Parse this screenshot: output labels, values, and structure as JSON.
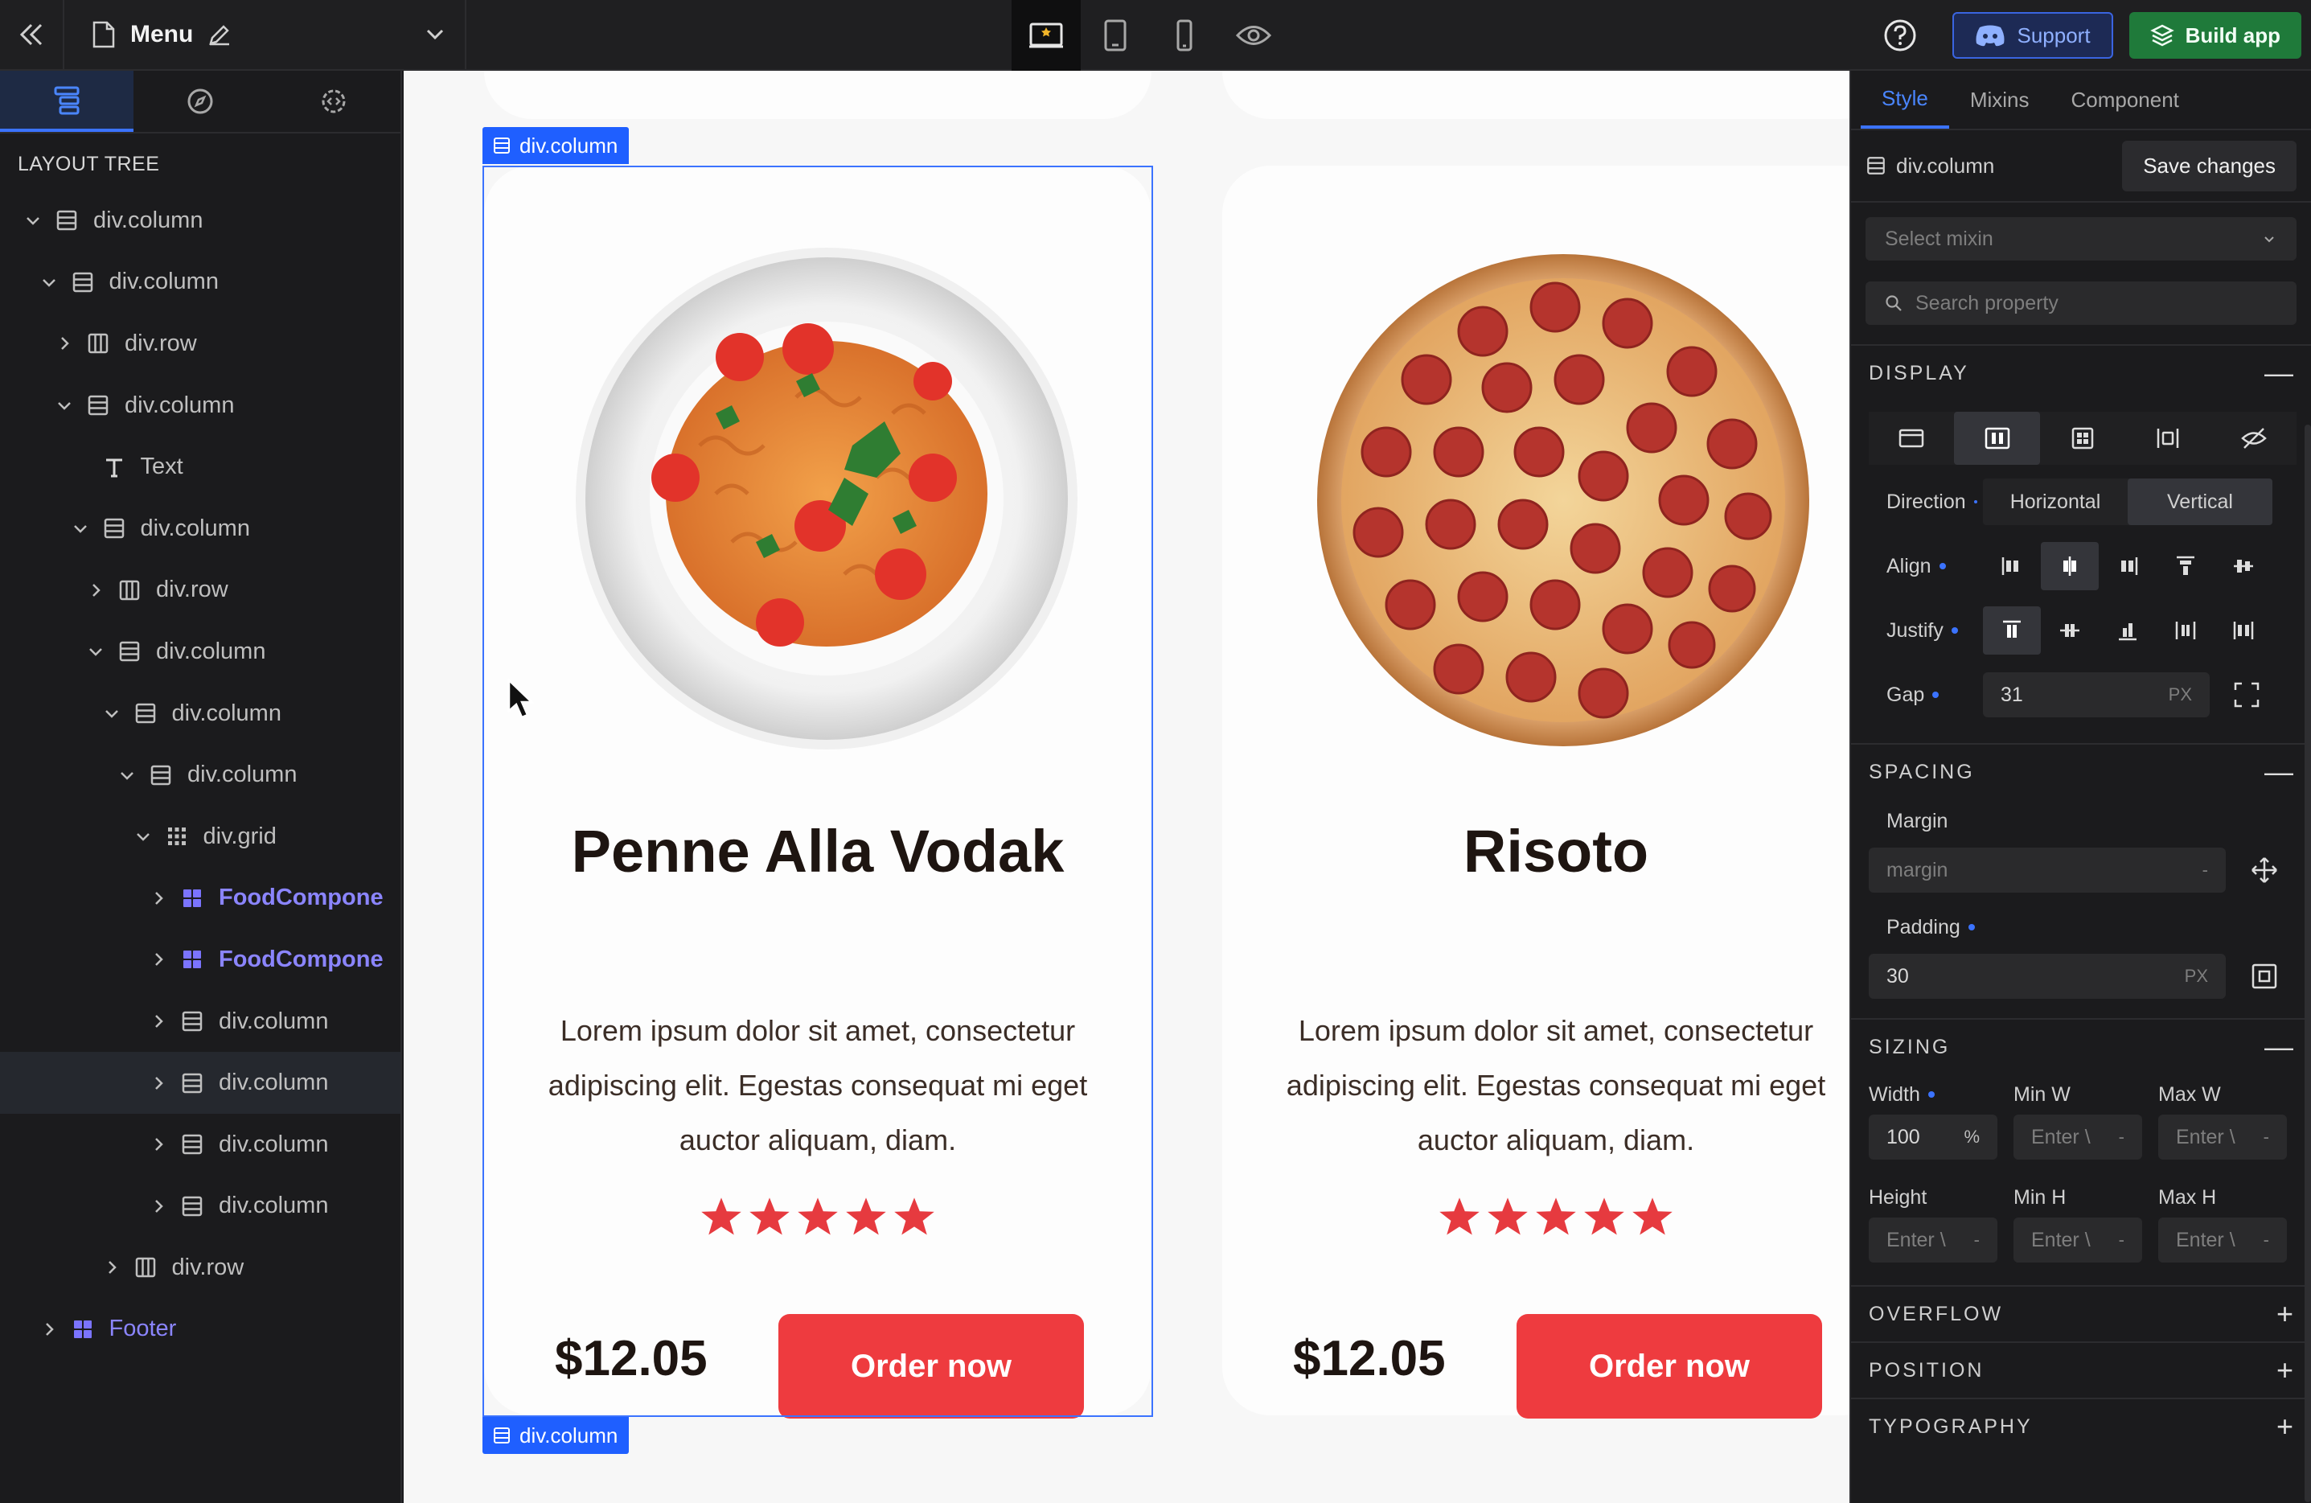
{
  "app": {
    "page_title": "Menu"
  },
  "topbar": {
    "support_label": "Support",
    "build_label": "Build app"
  },
  "left_panel": {
    "section_title": "LAYOUT TREE",
    "tree": [
      {
        "label": "div.column",
        "icon": "column-icon",
        "arrow": "down",
        "depth": 0
      },
      {
        "label": "div.column",
        "icon": "column-icon",
        "arrow": "down",
        "depth": 1
      },
      {
        "label": "div.row",
        "icon": "row-icon",
        "arrow": "right",
        "depth": 2
      },
      {
        "label": "div.column",
        "icon": "column-icon",
        "arrow": "down",
        "depth": 2
      },
      {
        "label": "Text",
        "icon": "text-icon",
        "arrow": "none",
        "depth": 3
      },
      {
        "label": "div.column",
        "icon": "column-icon",
        "arrow": "down",
        "depth": 3
      },
      {
        "label": "div.row",
        "icon": "row-icon",
        "arrow": "right",
        "depth": 4
      },
      {
        "label": "div.column",
        "icon": "column-icon",
        "arrow": "down",
        "depth": 4
      },
      {
        "label": "div.column",
        "icon": "column-icon",
        "arrow": "down",
        "depth": 5
      },
      {
        "label": "div.column",
        "icon": "column-icon",
        "arrow": "down",
        "depth": 6
      },
      {
        "label": "div.grid",
        "icon": "grid-icon",
        "arrow": "down",
        "depth": 7
      },
      {
        "label": "FoodCompone",
        "icon": "component-icon",
        "arrow": "right",
        "depth": 8,
        "kind": "component"
      },
      {
        "label": "FoodCompone",
        "icon": "component-icon",
        "arrow": "right",
        "depth": 8,
        "kind": "component"
      },
      {
        "label": "div.column",
        "icon": "column-icon",
        "arrow": "right",
        "depth": 8
      },
      {
        "label": "div.column",
        "icon": "column-icon",
        "arrow": "right",
        "depth": 8,
        "selected": true
      },
      {
        "label": "div.column",
        "icon": "column-icon",
        "arrow": "right",
        "depth": 8
      },
      {
        "label": "div.column",
        "icon": "column-icon",
        "arrow": "right",
        "depth": 8
      },
      {
        "label": "div.row",
        "icon": "row-icon",
        "arrow": "right",
        "depth": 5
      },
      {
        "label": "Footer",
        "icon": "component-icon",
        "arrow": "right",
        "depth": 1,
        "kind": "footer"
      }
    ]
  },
  "canvas": {
    "selection_label": "div.column",
    "cards": [
      {
        "title": "Penne Alla Vodak",
        "description": "Lorem ipsum dolor sit amet, consectetur adipiscing elit. Egestas consequat mi eget auctor aliquam, diam.",
        "rating": 5,
        "price": "$12.05",
        "button": "Order now",
        "image": "pasta-plate"
      },
      {
        "title": "Risoto",
        "description": "Lorem ipsum dolor sit amet, consectetur adipiscing elit. Egestas consequat mi eget auctor aliquam, diam.",
        "rating": 5,
        "price": "$12.05",
        "button": "Order now",
        "image": "pepperoni-pizza"
      }
    ]
  },
  "right_panel": {
    "tabs": [
      "Style",
      "Mixins",
      "Component"
    ],
    "active_tab": "Style",
    "element_class": "div.column",
    "save_label": "Save changes",
    "mixin_placeholder": "Select mixin",
    "search_placeholder": "Search property",
    "display": {
      "section": "DISPLAY",
      "direction_label": "Direction",
      "direction_options": [
        "Horizontal",
        "Vertical"
      ],
      "direction_value": "Vertical",
      "align_label": "Align",
      "justify_label": "Justify",
      "gap_label": "Gap",
      "gap_value": "31",
      "gap_unit": "PX"
    },
    "spacing": {
      "section": "SPACING",
      "margin_label": "Margin",
      "margin_placeholder": "margin",
      "padding_label": "Padding",
      "padding_value": "30",
      "padding_unit": "PX"
    },
    "sizing": {
      "section": "SIZING",
      "width_label": "Width",
      "width_value": "100",
      "width_unit": "%",
      "min_w_label": "Min W",
      "max_w_label": "Max W",
      "height_label": "Height",
      "min_h_label": "Min H",
      "max_h_label": "Max H",
      "enter_placeholder": "Enter \\"
    },
    "overflow_section": "OVERFLOW",
    "position_section": "POSITION",
    "typography_section": "TYPOGRAPHY"
  },
  "colors": {
    "accent": "#3b73ff",
    "order_button": "#ee3b3f",
    "star": "#e63a3f",
    "build_button": "#1f7a3a",
    "component_text": "#8b85ff"
  }
}
